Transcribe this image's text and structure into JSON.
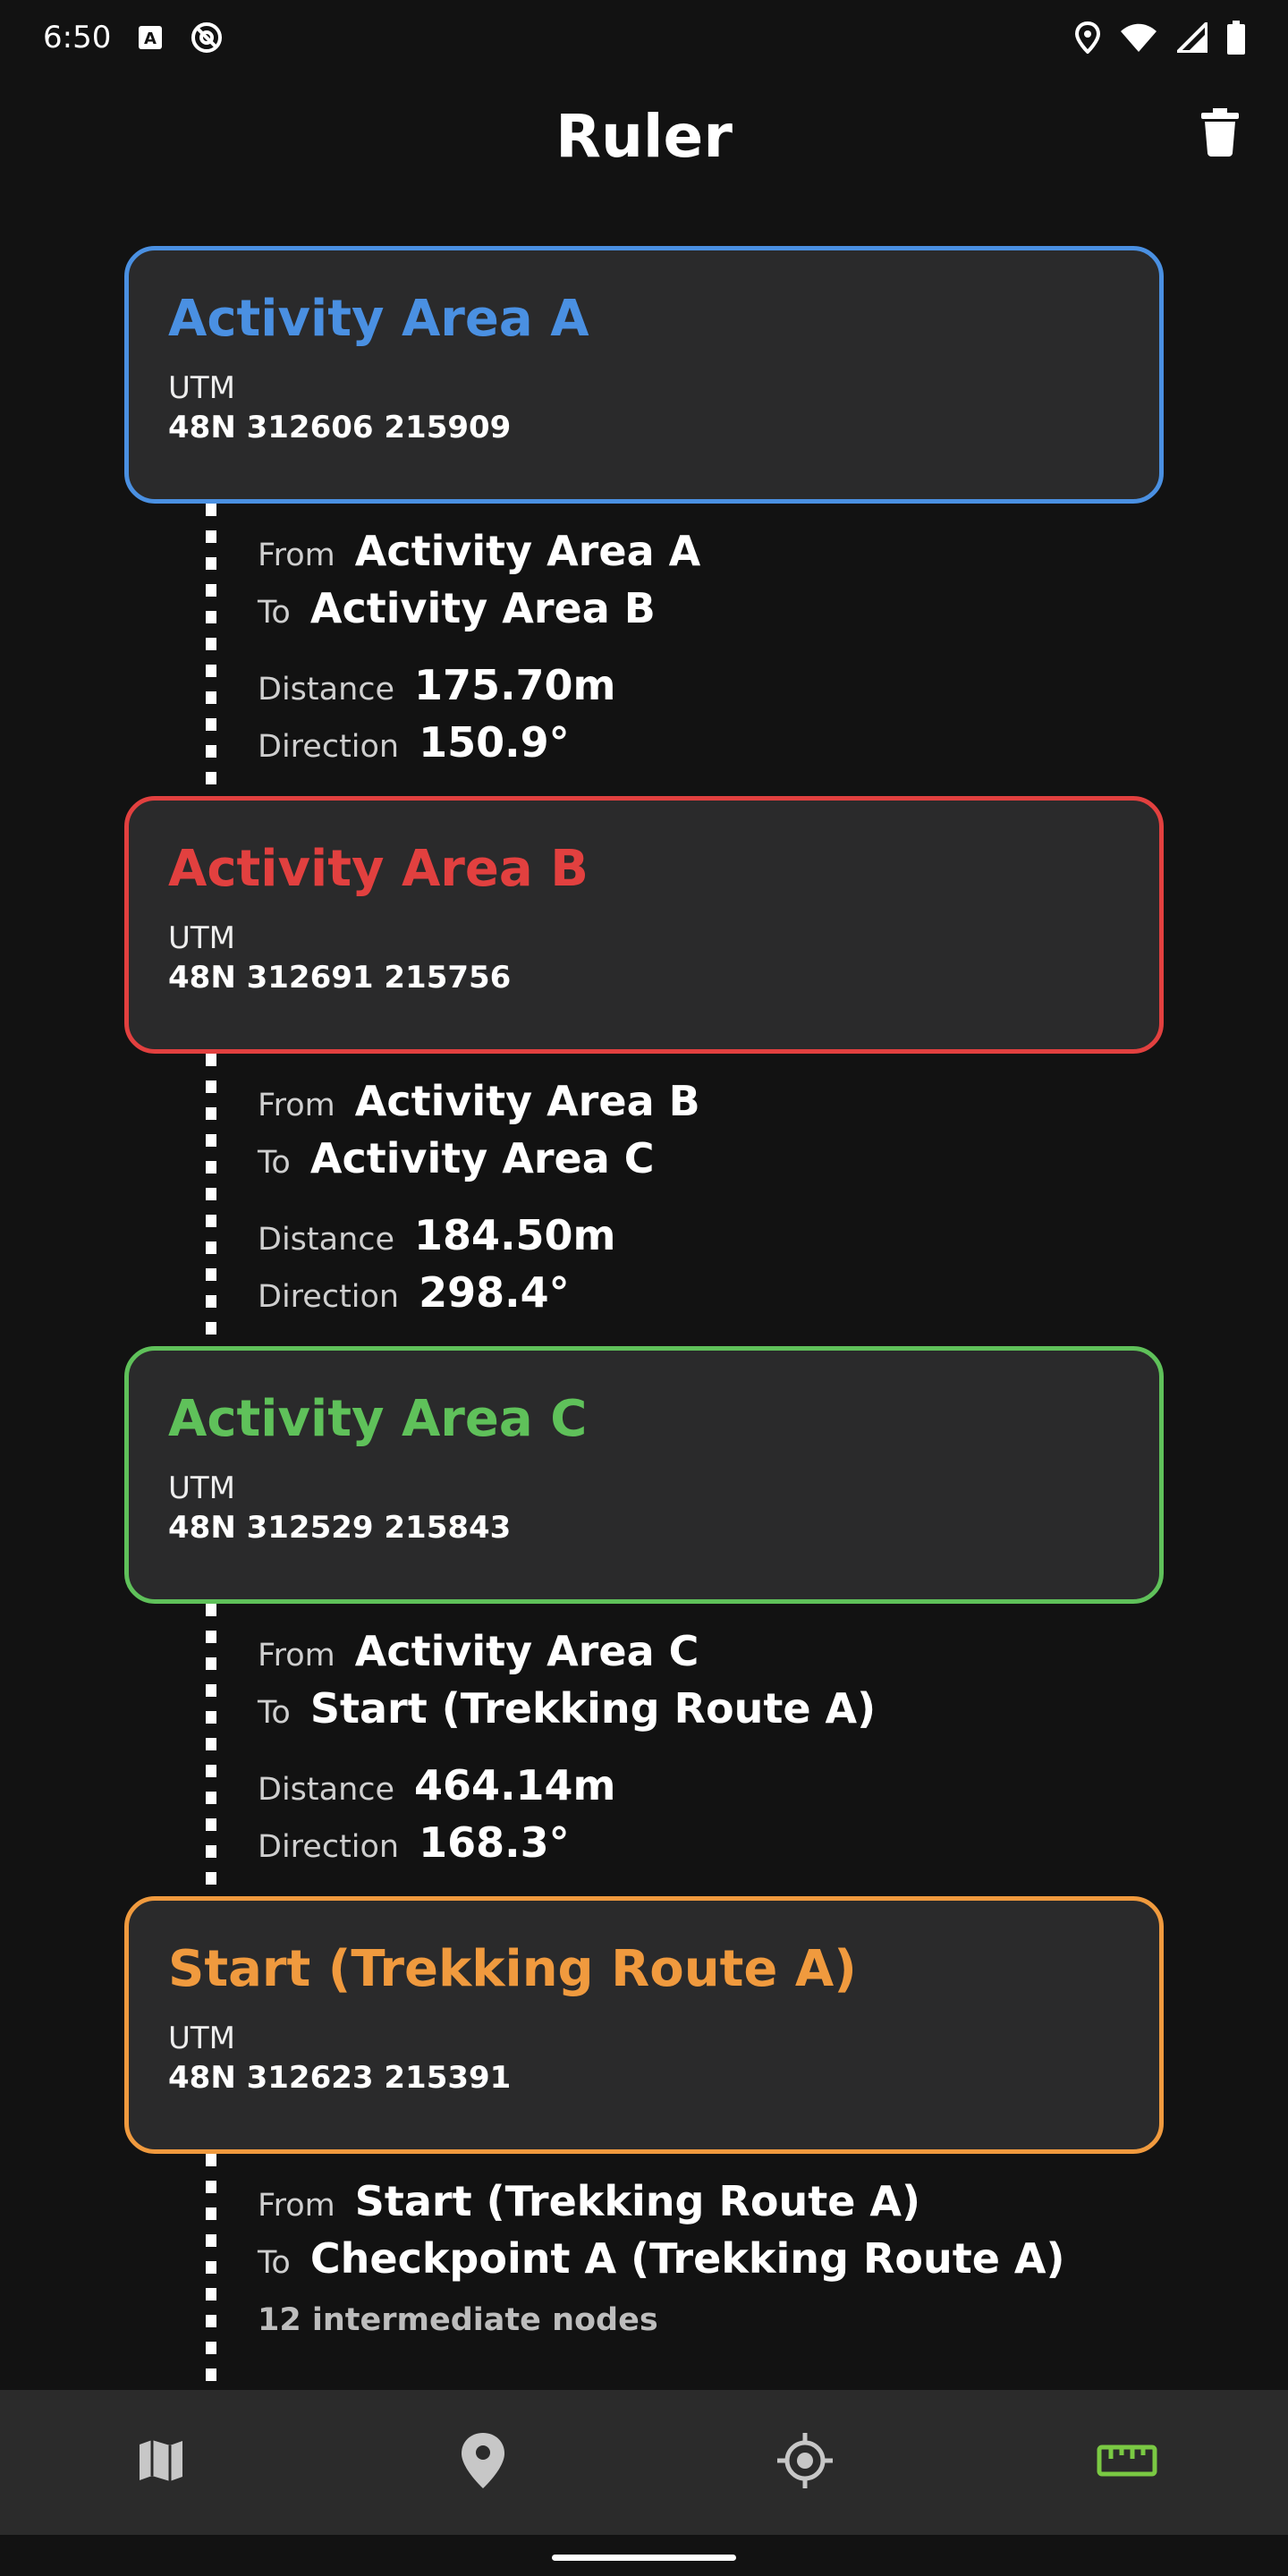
{
  "status_bar": {
    "time": "6:50",
    "left_icons": [
      "font-a-icon",
      "at-sign-icon"
    ],
    "right_icons": [
      "location-pin-icon",
      "wifi-icon",
      "cell-signal-icon",
      "battery-icon"
    ]
  },
  "header": {
    "title": "Ruler",
    "delete_icon": "trash-icon"
  },
  "points": [
    {
      "name": "Activity Area A",
      "color": "#4a90e2",
      "coord_label": "UTM",
      "coord_value": "48N 312606 215909"
    },
    {
      "name": "Activity Area B",
      "color": "#e2403f",
      "coord_label": "UTM",
      "coord_value": "48N 312691 215756"
    },
    {
      "name": "Activity Area C",
      "color": "#5fc15a",
      "coord_label": "UTM",
      "coord_value": "48N 312529 215843"
    },
    {
      "name": "Start (Trekking Route A)",
      "color": "#f09a3e",
      "coord_label": "UTM",
      "coord_value": "48N 312623 215391"
    }
  ],
  "labels": {
    "from": "From",
    "to": "To",
    "distance": "Distance",
    "direction": "Direction"
  },
  "segments": [
    {
      "from": "Activity Area A",
      "to": "Activity Area B",
      "distance": "175.70m",
      "direction": "150.9°"
    },
    {
      "from": "Activity Area B",
      "to": "Activity Area C",
      "distance": "184.50m",
      "direction": "298.4°"
    },
    {
      "from": "Activity Area C",
      "to": "Start (Trekking Route A)",
      "distance": "464.14m",
      "direction": "168.3°"
    },
    {
      "from": "Start (Trekking Route A)",
      "to": "Checkpoint A (Trekking Route A)",
      "intermediate": "12 intermediate nodes"
    }
  ],
  "bottom_nav": {
    "items": [
      {
        "icon": "map-icon",
        "color": "#c7c7c7",
        "active": false
      },
      {
        "icon": "place-pin-icon",
        "color": "#c7c7c7",
        "active": false
      },
      {
        "icon": "crosshair-icon",
        "color": "#c7c7c7",
        "active": false
      },
      {
        "icon": "ruler-icon",
        "color": "#7ac943",
        "active": true
      }
    ]
  }
}
